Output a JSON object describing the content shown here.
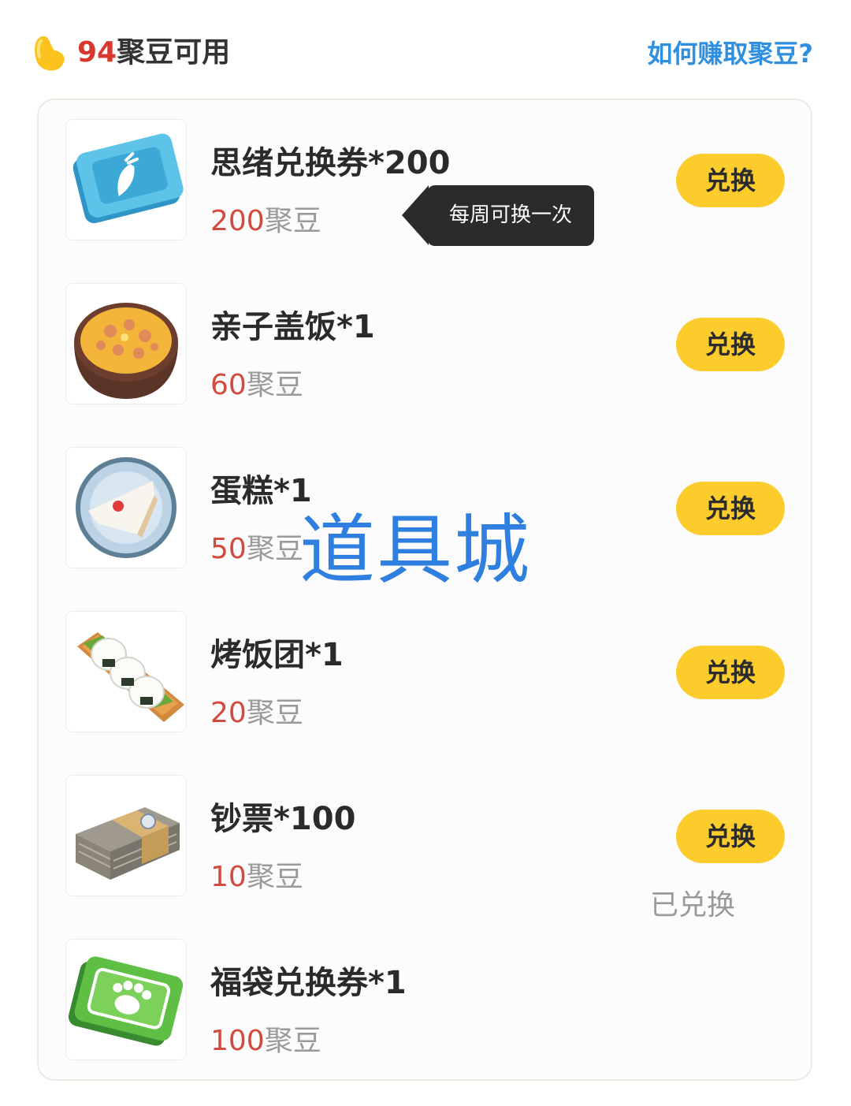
{
  "header": {
    "balance_number": "94",
    "balance_suffix": "聚豆可用",
    "earn_link": "如何赚取聚豆?"
  },
  "items": [
    {
      "name": "思绪兑换券*200",
      "price_number": "200",
      "price_unit": "聚豆",
      "action": "兑换",
      "icon": "ticket-carrot-icon"
    },
    {
      "name": "亲子盖饭*1",
      "price_number": "60",
      "price_unit": "聚豆",
      "action": "兑换",
      "icon": "rice-bowl-icon"
    },
    {
      "name": "蛋糕*1",
      "price_number": "50",
      "price_unit": "聚豆",
      "action": "兑换",
      "icon": "cake-icon"
    },
    {
      "name": "烤饭团*1",
      "price_number": "20",
      "price_unit": "聚豆",
      "action": "兑换",
      "icon": "rice-ball-icon"
    },
    {
      "name": "钞票*100",
      "price_number": "10",
      "price_unit": "聚豆",
      "action": "兑换",
      "icon": "banknotes-icon"
    },
    {
      "name": "福袋兑换券*1",
      "price_number": "100",
      "price_unit": "聚豆",
      "status": "已兑换",
      "icon": "ticket-paw-icon"
    }
  ],
  "tooltip": {
    "text": "每周可换一次"
  },
  "watermark": {
    "text": "道具城"
  },
  "colors": {
    "accent_yellow": "#fccc2c",
    "link_blue": "#2f8fe0",
    "price_red": "#d24b3f",
    "watermark_blue": "#2e7fe0"
  }
}
